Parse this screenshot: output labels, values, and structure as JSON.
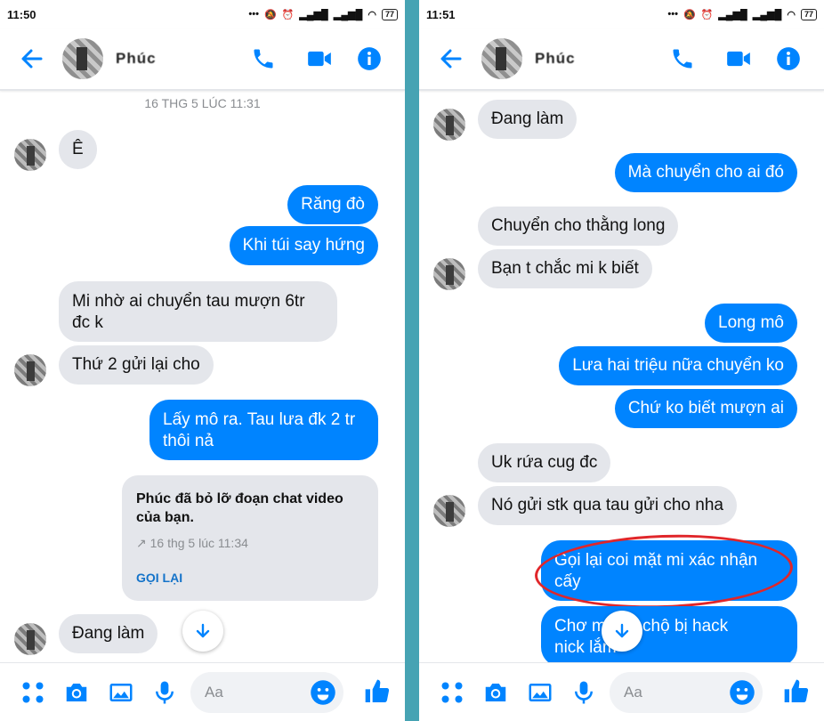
{
  "colors": {
    "accent": "#0084ff",
    "incoming_bubble": "#e4e6eb",
    "annotation": "#e0262a",
    "frame": "#46a3b3"
  },
  "left": {
    "status_time": "11:50",
    "battery": "77",
    "contact_name": "Phúc",
    "timestamp": "16 THG 5 LÚC 11:31",
    "messages": [
      {
        "text": "Ê"
      },
      {
        "text": "Răng đò"
      },
      {
        "text": "Khi túi say hứng"
      },
      {
        "line1": "Mi nhờ ai chuyển tau mượn 6tr",
        "line2": "đc k"
      },
      {
        "text": "Thứ 2 gửi lại cho"
      },
      {
        "line1": "Lấy mô ra. Tau lưa đk 2 tr",
        "line2": "thôi nả"
      },
      {
        "text": "Đang làm"
      }
    ],
    "missed_call": {
      "title": "Phúc đã bỏ lỡ đoạn chat video của bạn.",
      "meta": "↗ 16 thg 5 lúc 11:34",
      "action": "GỌI LẠI"
    },
    "composer_placeholder": "Aa"
  },
  "right": {
    "status_time": "11:51",
    "battery": "77",
    "contact_name": "Phúc",
    "messages": [
      {
        "text": "Đang làm"
      },
      {
        "text": "Mà chuyển cho ai đó"
      },
      {
        "text": "Chuyển cho thằng long"
      },
      {
        "text": "Bạn t chắc mi k biết"
      },
      {
        "text": "Long mô"
      },
      {
        "text": "Lưa hai triệu nữa chuyển ko"
      },
      {
        "text": "Chứ ko biết mượn ai"
      },
      {
        "text": "Uk rứa cug đc"
      },
      {
        "text": "Nó gửi stk qua tau gửi cho nha"
      },
      {
        "line1": "Gọi lại coi mặt mi xác nhận",
        "line2": "cấy"
      },
      {
        "line1": "Chơ m     hay chộ bị hack",
        "line2": "nick lắm"
      }
    ],
    "composer_placeholder": "Aa"
  },
  "icons": [
    "back-arrow-icon",
    "phone-icon",
    "video-camera-icon",
    "info-icon",
    "apps-grid-icon",
    "camera-icon",
    "image-icon",
    "microphone-icon",
    "emoji-icon",
    "thumbs-up-icon",
    "arrow-down-icon"
  ]
}
